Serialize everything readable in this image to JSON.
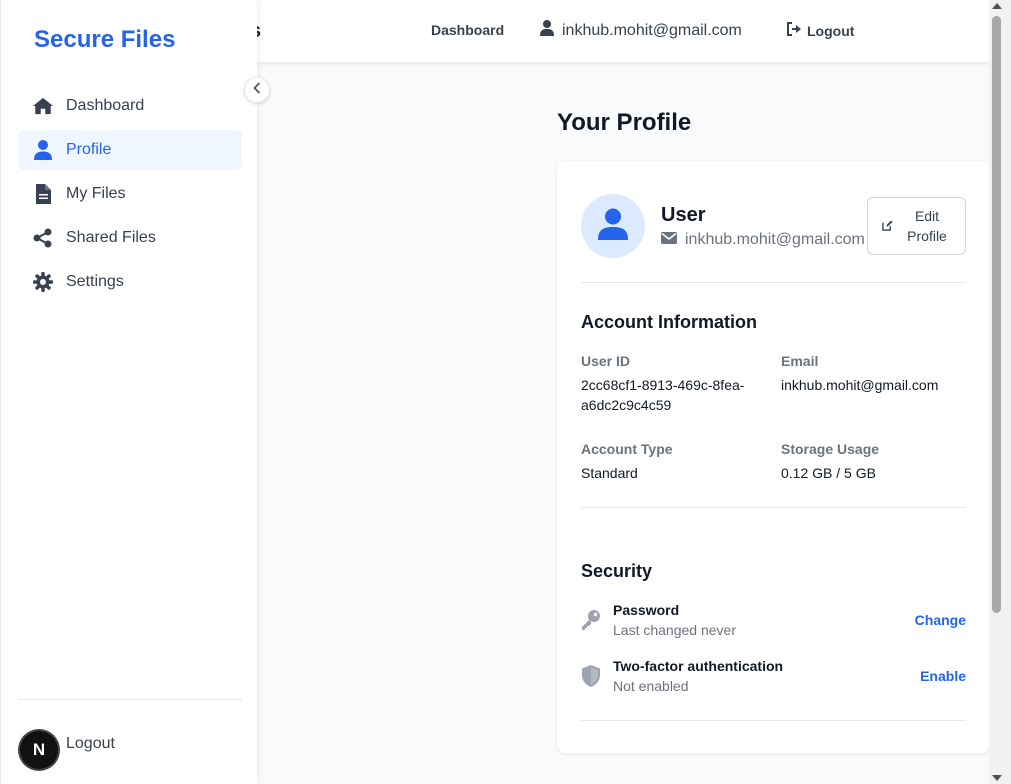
{
  "header": {
    "brand_partial": "s",
    "nav_dashboard": "Dashboard",
    "user_email": "inkhub.mohit@gmail.com",
    "logout": "Logout"
  },
  "sidebar": {
    "logo": "Secure Files",
    "items": [
      {
        "label": "Dashboard",
        "icon": "home-icon",
        "active": false
      },
      {
        "label": "Profile",
        "icon": "user-icon",
        "active": true
      },
      {
        "label": "My Files",
        "icon": "file-icon",
        "active": false
      },
      {
        "label": "Shared Files",
        "icon": "share-icon",
        "active": false
      },
      {
        "label": "Settings",
        "icon": "gear-icon",
        "active": false
      }
    ],
    "logout": "Logout",
    "badge": "N"
  },
  "main": {
    "page_title": "Your Profile",
    "profile": {
      "name": "User",
      "email": "inkhub.mohit@gmail.com",
      "edit_button": "Edit Profile"
    },
    "account_info": {
      "title": "Account Information",
      "user_id_label": "User ID",
      "user_id_line1": "2cc68cf1-8913-469c-8fea-",
      "user_id_line2": "a6dc2c9c4c59",
      "email_label": "Email",
      "email_value": "inkhub.mohit@gmail.com",
      "account_type_label": "Account Type",
      "account_type_value": "Standard",
      "storage_label": "Storage Usage",
      "storage_value": "0.12 GB / 5 GB"
    },
    "security": {
      "title": "Security",
      "password_title": "Password",
      "password_sub": "Last changed never",
      "password_action": "Change",
      "twofa_title": "Two-factor authentication",
      "twofa_sub": "Not enabled",
      "twofa_action": "Enable"
    }
  },
  "colors": {
    "accent": "#2563eb",
    "active_bg": "#eff6ff",
    "avatar_bg": "#dbeafe",
    "text_muted": "#6b7280"
  }
}
